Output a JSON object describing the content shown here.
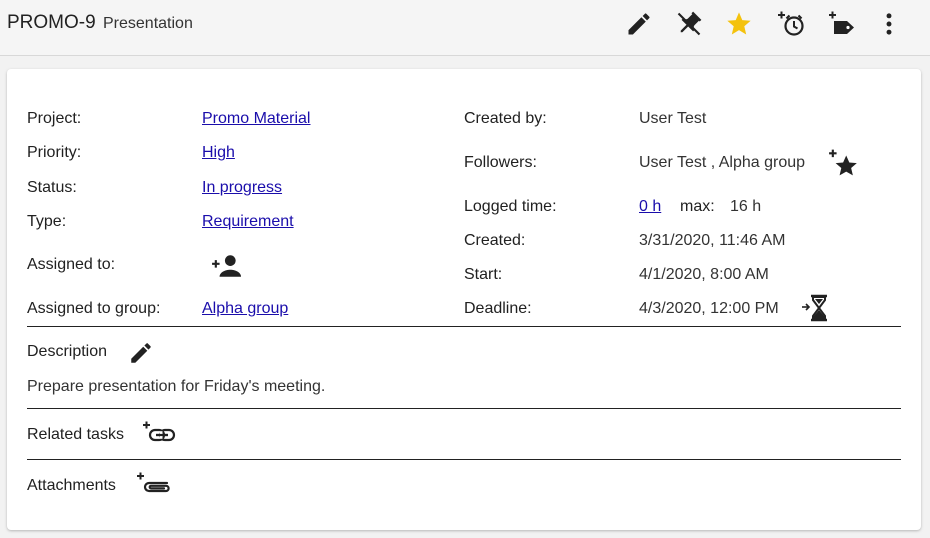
{
  "header": {
    "task_id": "PROMO-9",
    "task_type": "Presentation",
    "icons": [
      "edit-icon",
      "pin-icon",
      "star-icon",
      "add-alarm-icon",
      "add-tag-icon",
      "more-vert-icon"
    ],
    "star_color": "#f4c20d"
  },
  "details": {
    "project_label": "Project:",
    "project_value": "Promo Material",
    "priority_label": "Priority:",
    "priority_value": "High",
    "status_label": "Status:",
    "status_value": "In progress",
    "type_label": "Type:",
    "type_value": "Requirement",
    "assigned_label": "Assigned to:",
    "assigned_group_label": "Assigned to group:",
    "assigned_group_value": "Alpha group",
    "created_by_label": "Created by:",
    "created_by_value": "User Test",
    "followers_label": "Followers:",
    "followers_value": "User Test , Alpha group",
    "logged_label": "Logged time:",
    "logged_value": "0 h",
    "max_label": "max:",
    "max_value": "16 h",
    "created_label": "Created:",
    "created_value": "3/31/2020, 11:46 AM",
    "start_label": "Start:",
    "start_value": "4/1/2020, 8:00 AM",
    "deadline_label": "Deadline:",
    "deadline_value": "4/3/2020, 12:00 PM"
  },
  "description": {
    "label": "Description",
    "text": "Prepare presentation for Friday's meeting."
  },
  "related": {
    "label": "Related tasks"
  },
  "attachments": {
    "label": "Attachments"
  },
  "link_color": "#1a0dab"
}
